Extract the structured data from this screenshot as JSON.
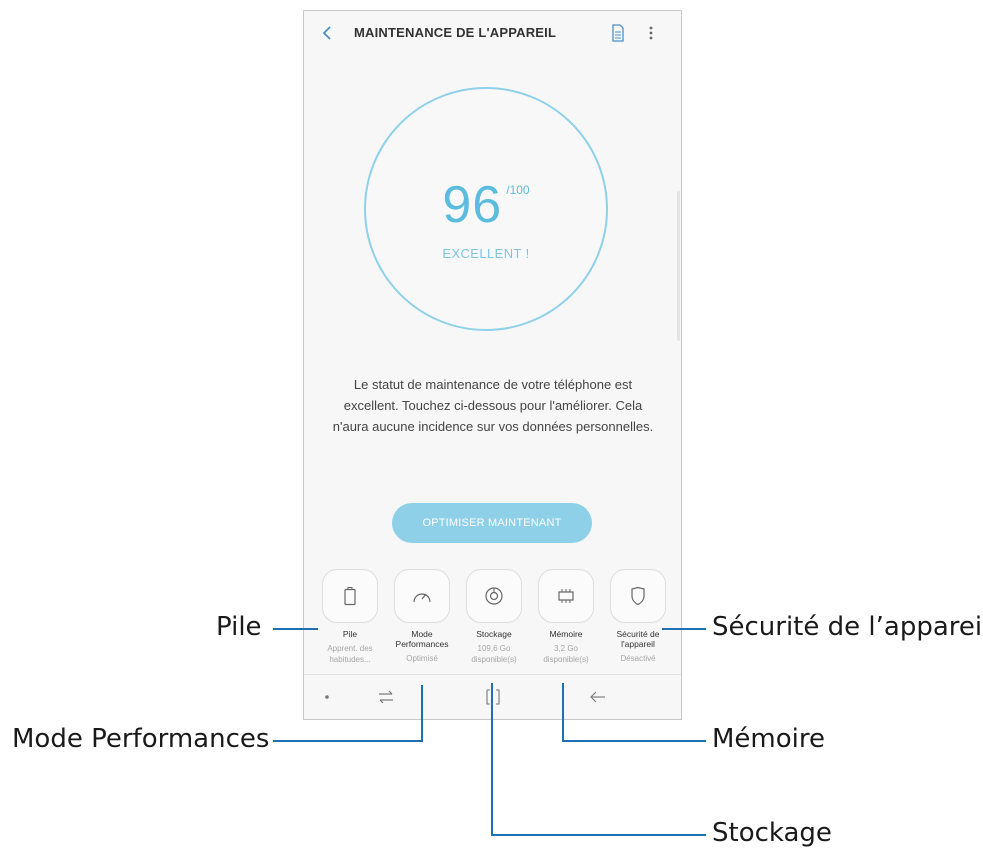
{
  "appbar": {
    "title": "MAINTENANCE DE L'APPAREIL",
    "back_icon": "chevron-left-icon",
    "report_icon": "report-icon",
    "more_icon": "more-vertical-icon"
  },
  "score": {
    "value": "96",
    "max": "/100",
    "rating": "EXCELLENT !"
  },
  "description": "Le statut de maintenance de votre téléphone est excellent. Touchez ci-dessous pour l'améliorer. Cela n'aura aucune incidence sur vos données personnelles.",
  "optimize_button": "OPTIMISER MAINTENANT",
  "categories": [
    {
      "label": "Pile",
      "sub": "Apprent. des habitudes...",
      "icon": "battery-icon"
    },
    {
      "label": "Mode Performances",
      "sub": "Optimisé",
      "icon": "gauge-icon"
    },
    {
      "label": "Stockage",
      "sub": "109,6 Go disponible(s)",
      "icon": "storage-icon"
    },
    {
      "label": "Mémoire",
      "sub": "3,2 Go disponible(s)",
      "icon": "memory-chip-icon"
    },
    {
      "label": "Sécurité de l'appareil",
      "sub": "Désactivé",
      "icon": "shield-icon"
    }
  ],
  "navbar": {
    "dot_icon": "dot-icon",
    "recents_icon": "recent-apps-icon",
    "home_icon": "home-icon",
    "back_icon": "back-arrow-icon"
  },
  "callouts": {
    "pile": "Pile",
    "mode": "Mode Performances",
    "securite": "Sécurité de l’appareil",
    "memoire": "Mémoire",
    "stockage": "Stockage"
  },
  "colors": {
    "accent": "#5cbcde",
    "button": "#8ed0e8",
    "callout_line": "#1f6fb2"
  }
}
